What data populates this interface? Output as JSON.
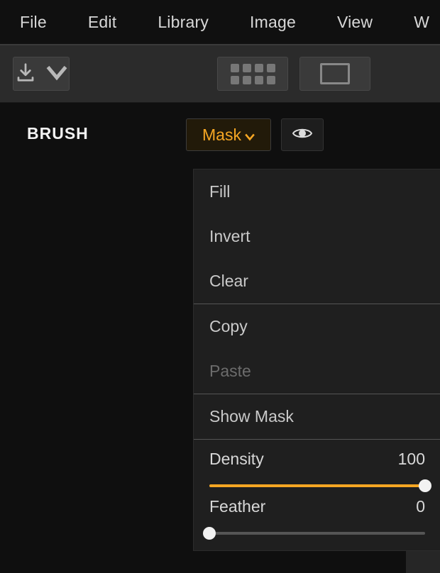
{
  "menu": {
    "items": [
      "File",
      "Edit",
      "Library",
      "Image",
      "View",
      "W"
    ]
  },
  "toolbar": {
    "download": "download-icon",
    "grid": "grid-view-icon",
    "single": "single-view-icon"
  },
  "tool": {
    "name": "BRUSH",
    "mask_label": "Mask"
  },
  "dropdown": {
    "items": [
      {
        "key": "fill",
        "label": "Fill",
        "type": "item"
      },
      {
        "key": "invert",
        "label": "Invert",
        "type": "item"
      },
      {
        "key": "clear",
        "label": "Clear",
        "type": "item"
      },
      {
        "type": "sep"
      },
      {
        "key": "copy",
        "label": "Copy",
        "type": "item"
      },
      {
        "key": "paste",
        "label": "Paste",
        "type": "item",
        "disabled": true
      },
      {
        "type": "sep"
      },
      {
        "key": "show_mask",
        "label": "Show Mask",
        "type": "item"
      }
    ],
    "sliders": {
      "density": {
        "label": "Density",
        "value": 100,
        "max": 100
      },
      "feather": {
        "label": "Feather",
        "value": 0,
        "max": 100
      }
    }
  },
  "colors": {
    "accent": "#f5a623",
    "bg": "#0f0f0f",
    "panel": "#1f1f1f"
  }
}
